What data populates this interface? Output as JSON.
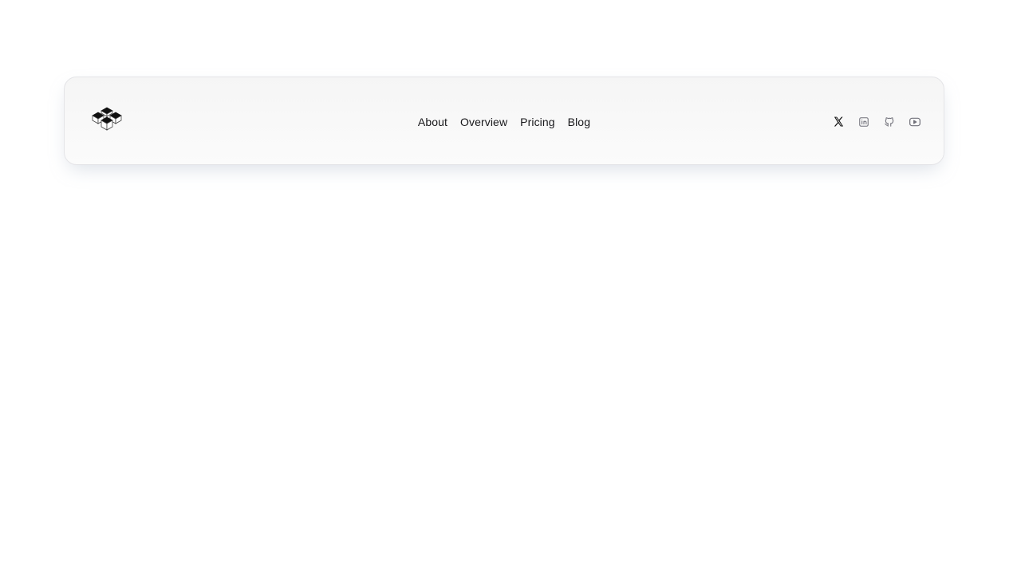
{
  "navbar": {
    "links": [
      {
        "label": "About"
      },
      {
        "label": "Overview"
      },
      {
        "label": "Pricing"
      },
      {
        "label": "Blog"
      }
    ],
    "socials": [
      {
        "icon": "x-twitter-icon",
        "color": "#111111"
      },
      {
        "icon": "linkedin-icon",
        "color": "#71717a"
      },
      {
        "icon": "github-icon",
        "color": "#71717a"
      },
      {
        "icon": "youtube-icon",
        "color": "#71717a"
      }
    ]
  },
  "colors": {
    "text": "#18181b",
    "icon_muted": "#71717a",
    "border": "#e4e4e7"
  }
}
